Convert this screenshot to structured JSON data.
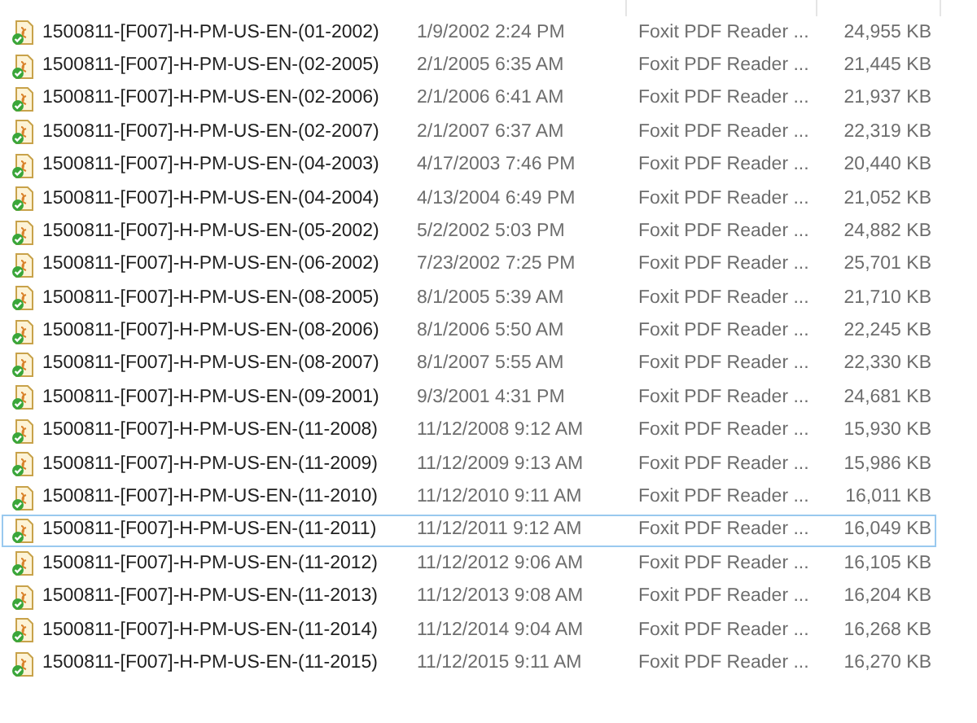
{
  "files": [
    {
      "name": "1500811-[F007]-H-PM-US-EN-(01-2002)",
      "date": "1/9/2002 2:24 PM",
      "type": "Foxit PDF Reader ...",
      "size": "24,955 KB",
      "focused": false
    },
    {
      "name": "1500811-[F007]-H-PM-US-EN-(02-2005)",
      "date": "2/1/2005 6:35 AM",
      "type": "Foxit PDF Reader ...",
      "size": "21,445 KB",
      "focused": false
    },
    {
      "name": "1500811-[F007]-H-PM-US-EN-(02-2006)",
      "date": "2/1/2006 6:41 AM",
      "type": "Foxit PDF Reader ...",
      "size": "21,937 KB",
      "focused": false
    },
    {
      "name": "1500811-[F007]-H-PM-US-EN-(02-2007)",
      "date": "2/1/2007 6:37 AM",
      "type": "Foxit PDF Reader ...",
      "size": "22,319 KB",
      "focused": false
    },
    {
      "name": "1500811-[F007]-H-PM-US-EN-(04-2003)",
      "date": "4/17/2003 7:46 PM",
      "type": "Foxit PDF Reader ...",
      "size": "20,440 KB",
      "focused": false
    },
    {
      "name": "1500811-[F007]-H-PM-US-EN-(04-2004)",
      "date": "4/13/2004 6:49 PM",
      "type": "Foxit PDF Reader ...",
      "size": "21,052 KB",
      "focused": false
    },
    {
      "name": "1500811-[F007]-H-PM-US-EN-(05-2002)",
      "date": "5/2/2002 5:03 PM",
      "type": "Foxit PDF Reader ...",
      "size": "24,882 KB",
      "focused": false
    },
    {
      "name": "1500811-[F007]-H-PM-US-EN-(06-2002)",
      "date": "7/23/2002 7:25 PM",
      "type": "Foxit PDF Reader ...",
      "size": "25,701 KB",
      "focused": false
    },
    {
      "name": "1500811-[F007]-H-PM-US-EN-(08-2005)",
      "date": "8/1/2005 5:39 AM",
      "type": "Foxit PDF Reader ...",
      "size": "21,710 KB",
      "focused": false
    },
    {
      "name": "1500811-[F007]-H-PM-US-EN-(08-2006)",
      "date": "8/1/2006 5:50 AM",
      "type": "Foxit PDF Reader ...",
      "size": "22,245 KB",
      "focused": false
    },
    {
      "name": "1500811-[F007]-H-PM-US-EN-(08-2007)",
      "date": "8/1/2007 5:55 AM",
      "type": "Foxit PDF Reader ...",
      "size": "22,330 KB",
      "focused": false
    },
    {
      "name": "1500811-[F007]-H-PM-US-EN-(09-2001)",
      "date": "9/3/2001 4:31 PM",
      "type": "Foxit PDF Reader ...",
      "size": "24,681 KB",
      "focused": false
    },
    {
      "name": "1500811-[F007]-H-PM-US-EN-(11-2008)",
      "date": "11/12/2008 9:12 AM",
      "type": "Foxit PDF Reader ...",
      "size": "15,930 KB",
      "focused": false
    },
    {
      "name": "1500811-[F007]-H-PM-US-EN-(11-2009)",
      "date": "11/12/2009 9:13 AM",
      "type": "Foxit PDF Reader ...",
      "size": "15,986 KB",
      "focused": false
    },
    {
      "name": "1500811-[F007]-H-PM-US-EN-(11-2010)",
      "date": "11/12/2010 9:11 AM",
      "type": "Foxit PDF Reader ...",
      "size": "16,011 KB",
      "focused": false
    },
    {
      "name": "1500811-[F007]-H-PM-US-EN-(11-2011)",
      "date": "11/12/2011 9:12 AM",
      "type": "Foxit PDF Reader ...",
      "size": "16,049 KB",
      "focused": true
    },
    {
      "name": "1500811-[F007]-H-PM-US-EN-(11-2012)",
      "date": "11/12/2012 9:06 AM",
      "type": "Foxit PDF Reader ...",
      "size": "16,105 KB",
      "focused": false
    },
    {
      "name": "1500811-[F007]-H-PM-US-EN-(11-2013)",
      "date": "11/12/2013 9:08 AM",
      "type": "Foxit PDF Reader ...",
      "size": "16,204 KB",
      "focused": false
    },
    {
      "name": "1500811-[F007]-H-PM-US-EN-(11-2014)",
      "date": "11/12/2014 9:04 AM",
      "type": "Foxit PDF Reader ...",
      "size": "16,268 KB",
      "focused": false
    },
    {
      "name": "1500811-[F007]-H-PM-US-EN-(11-2015)",
      "date": "11/12/2015 9:11 AM",
      "type": "Foxit PDF Reader ...",
      "size": "16,270 KB",
      "focused": false
    }
  ]
}
